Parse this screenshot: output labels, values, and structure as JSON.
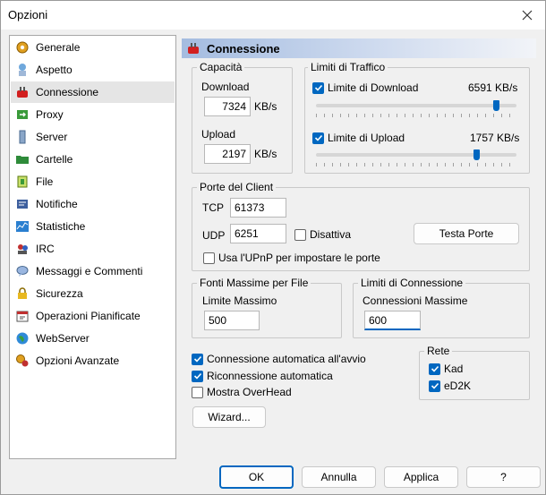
{
  "window": {
    "title": "Opzioni"
  },
  "sidebar": {
    "items": [
      {
        "label": "Generale",
        "icon": "gear-icon"
      },
      {
        "label": "Aspetto",
        "icon": "appearance-icon"
      },
      {
        "label": "Connessione",
        "icon": "connection-icon",
        "selected": true
      },
      {
        "label": "Proxy",
        "icon": "proxy-icon"
      },
      {
        "label": "Server",
        "icon": "server-icon"
      },
      {
        "label": "Cartelle",
        "icon": "folder-icon"
      },
      {
        "label": "File",
        "icon": "file-icon"
      },
      {
        "label": "Notifiche",
        "icon": "notification-icon"
      },
      {
        "label": "Statistiche",
        "icon": "statistics-icon"
      },
      {
        "label": "IRC",
        "icon": "irc-icon"
      },
      {
        "label": "Messaggi e Commenti",
        "icon": "messages-icon"
      },
      {
        "label": "Sicurezza",
        "icon": "lock-icon"
      },
      {
        "label": "Operazioni Pianificate",
        "icon": "schedule-icon"
      },
      {
        "label": "WebServer",
        "icon": "globe-icon"
      },
      {
        "label": "Opzioni Avanzate",
        "icon": "advanced-icon"
      }
    ]
  },
  "panel": {
    "title": "Connessione"
  },
  "capacity": {
    "legend": "Capacità",
    "download_label": "Download",
    "download_value": "7324",
    "download_unit": "KB/s",
    "upload_label": "Upload",
    "upload_value": "2197",
    "upload_unit": "KB/s"
  },
  "traffic": {
    "legend": "Limiti di Traffico",
    "download_limit_label": "Limite di Download",
    "download_limit_checked": true,
    "download_limit_value": "6591 KB/s",
    "download_slider_fraction": 0.9,
    "upload_limit_label": "Limite di Upload",
    "upload_limit_checked": true,
    "upload_limit_value": "1757 KB/s",
    "upload_slider_fraction": 0.8
  },
  "ports": {
    "legend": "Porte del Client",
    "tcp_label": "TCP",
    "tcp_value": "61373",
    "udp_label": "UDP",
    "udp_value": "6251",
    "disable_label": "Disattiva",
    "disable_checked": false,
    "test_button": "Testa Porte",
    "upnp_label": "Usa l'UPnP per impostare le porte",
    "upnp_checked": false
  },
  "sources": {
    "legend": "Fonti Massime per File",
    "limit_label": "Limite Massimo",
    "limit_value": "500"
  },
  "conn_limits": {
    "legend": "Limiti di Connessione",
    "max_label": "Connessioni Massime",
    "max_value": "600"
  },
  "options": {
    "auto_connect_label": "Connessione automatica all'avvio",
    "auto_connect_checked": true,
    "reconnect_label": "Riconnessione automatica",
    "reconnect_checked": true,
    "overhead_label": "Mostra OverHead",
    "overhead_checked": false
  },
  "network": {
    "legend": "Rete",
    "kad_label": "Kad",
    "kad_checked": true,
    "ed2k_label": "eD2K",
    "ed2k_checked": true
  },
  "wizard_button": "Wizard...",
  "footer": {
    "ok": "OK",
    "cancel": "Annulla",
    "apply": "Applica",
    "help": "?"
  }
}
